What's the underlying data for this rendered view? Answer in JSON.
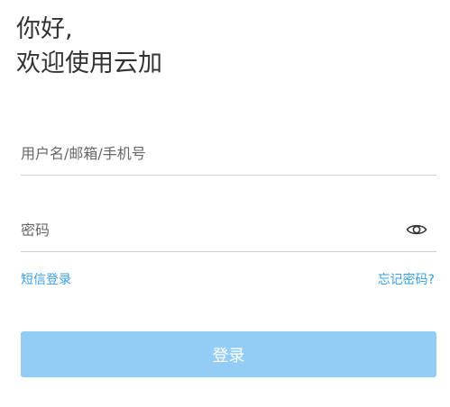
{
  "greeting": {
    "line1": "你好,",
    "line2": "欢迎使用云加"
  },
  "username_field": {
    "placeholder": "用户名/邮箱/手机号",
    "value": ""
  },
  "password_field": {
    "placeholder": "密码",
    "value": "",
    "toggle_icon": "eye-icon"
  },
  "links": {
    "sms_login": "短信登录",
    "forgot_password": "忘记密码?"
  },
  "login_button": {
    "label": "登录"
  },
  "colors": {
    "accent": "#3aa0e6",
    "button_disabled_bg": "#93ccf5",
    "text": "#333333",
    "divider": "#cfcfcf"
  }
}
